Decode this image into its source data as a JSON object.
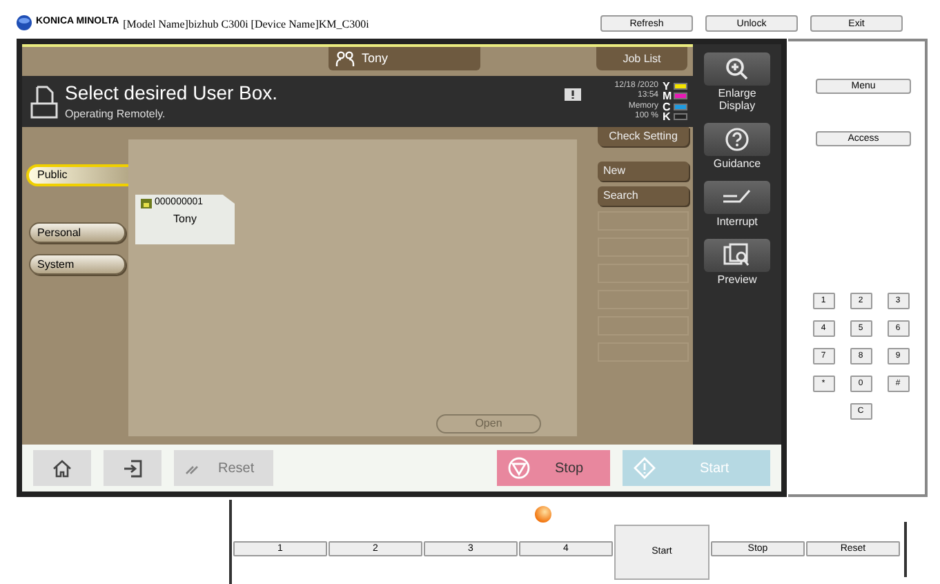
{
  "header": {
    "brand": "KONICA MINOLTA",
    "model_info": "[Model Name]bizhub C300i [Device Name]KM_C300i",
    "buttons": [
      "Refresh",
      "Unlock",
      "Exit"
    ]
  },
  "panel": {
    "user_tab": "Tony",
    "job_list": "Job List",
    "message": "Select desired User Box.",
    "sub_message": "Operating Remotely.",
    "date": "12/18 /2020",
    "time": "13:54",
    "memory_label": "Memory",
    "memory_value": "100 %",
    "toners": [
      {
        "letter": "Y",
        "color": "#f5e400",
        "level": 1
      },
      {
        "letter": "M",
        "color": "#e81ab5",
        "level": 1
      },
      {
        "letter": "C",
        "color": "#1e9be0",
        "level": 1
      },
      {
        "letter": "K",
        "color": "#222222",
        "level": 1
      }
    ],
    "categories": [
      {
        "label": "Public",
        "selected": true
      },
      {
        "label": "Personal",
        "selected": false
      },
      {
        "label": "System",
        "selected": false
      }
    ],
    "boxes": [
      {
        "number": "000000001",
        "name": "Tony"
      }
    ],
    "open_button": "Open",
    "action_buttons": [
      {
        "label": "Check Setting",
        "kind": "setting"
      },
      {
        "label": "New",
        "kind": "action"
      },
      {
        "label": "Search",
        "kind": "action"
      }
    ],
    "side_keys": [
      {
        "label": "Enlarge Display",
        "kind": "enlarge"
      },
      {
        "label": "Guidance",
        "kind": "guidance"
      },
      {
        "label": "Interrupt",
        "kind": "interrupt"
      },
      {
        "label": "Preview",
        "kind": "preview"
      }
    ],
    "reset": "Reset",
    "stop": "Stop",
    "start": "Start"
  },
  "side_panel": {
    "buttons": [
      "Menu",
      "Access"
    ],
    "keypad": [
      "1",
      "2",
      "3",
      "4",
      "5",
      "6",
      "7",
      "8",
      "9",
      "*",
      "0",
      "#",
      "C"
    ]
  },
  "bottom_bar": {
    "buttons": [
      {
        "label": "1",
        "kind": "small"
      },
      {
        "label": "2",
        "kind": "small"
      },
      {
        "label": "3",
        "kind": "small"
      },
      {
        "label": "4",
        "kind": "small"
      },
      {
        "label": "Start",
        "kind": "large"
      },
      {
        "label": "Stop",
        "kind": "small"
      },
      {
        "label": "Reset",
        "kind": "small"
      }
    ]
  }
}
